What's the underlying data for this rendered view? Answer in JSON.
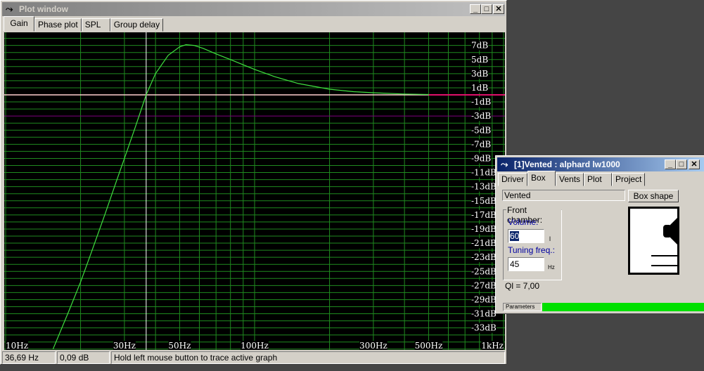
{
  "plot_window": {
    "title": "Plot window",
    "tabs": [
      {
        "label": "Gain",
        "active": true
      },
      {
        "label": "Phase plot"
      },
      {
        "label": "SPL"
      },
      {
        "label": "Group delay"
      }
    ],
    "status": {
      "freq": "36,69 Hz",
      "gain": "0,09 dB",
      "hint": "Hold left mouse button to trace active graph"
    }
  },
  "chart_data": {
    "type": "line",
    "xscale": "log",
    "xlim": [
      10,
      1000
    ],
    "ylim": [
      -36,
      9
    ],
    "grid": true,
    "x_tick_labels": [
      {
        "v": 10,
        "t": "10Hz"
      },
      {
        "v": 30,
        "t": "30Hz"
      },
      {
        "v": 50,
        "t": "50Hz"
      },
      {
        "v": 100,
        "t": "100Hz"
      },
      {
        "v": 300,
        "t": "300Hz"
      },
      {
        "v": 500,
        "t": "500Hz"
      },
      {
        "v": 1000,
        "t": "1kHz"
      }
    ],
    "y_tick_labels": [
      {
        "v": 7,
        "t": "7dB"
      },
      {
        "v": 5,
        "t": "5dB"
      },
      {
        "v": 3,
        "t": "3dB"
      },
      {
        "v": 1,
        "t": "1dB"
      },
      {
        "v": -1,
        "t": "-1dB"
      },
      {
        "v": -3,
        "t": "-3dB"
      },
      {
        "v": -5,
        "t": "-5dB"
      },
      {
        "v": -7,
        "t": "-7dB"
      },
      {
        "v": -9,
        "t": "-9dB"
      },
      {
        "v": -11,
        "t": "-11dB"
      },
      {
        "v": -13,
        "t": "-13dB"
      },
      {
        "v": -15,
        "t": "-15dB"
      },
      {
        "v": -17,
        "t": "-17dB"
      },
      {
        "v": -19,
        "t": "-19dB"
      },
      {
        "v": -21,
        "t": "-21dB"
      },
      {
        "v": -23,
        "t": "-23dB"
      },
      {
        "v": -25,
        "t": "-25dB"
      },
      {
        "v": -27,
        "t": "-27dB"
      },
      {
        "v": -29,
        "t": "-29dB"
      },
      {
        "v": -31,
        "t": "-31dB"
      },
      {
        "v": -33,
        "t": "-33dB"
      }
    ],
    "cursor_x": 36.69,
    "series": [
      {
        "color": "#40e040",
        "x": [
          15.5,
          18,
          20,
          22,
          25,
          28,
          30,
          33,
          36.69,
          40,
          45,
          50,
          53,
          57,
          62,
          70,
          80,
          100,
          120,
          150,
          200,
          250,
          300,
          400,
          500
        ],
        "y": [
          -36,
          -30.5,
          -26.5,
          -22.5,
          -17,
          -12,
          -9,
          -4.8,
          0,
          3,
          5.6,
          6.8,
          7.1,
          7.0,
          6.6,
          5.8,
          5,
          3.6,
          2.6,
          1.6,
          0.8,
          0.45,
          0.3,
          0.12,
          0.05
        ]
      }
    ],
    "reference_lines": [
      {
        "y": 0,
        "color": "#ffd0d0"
      },
      {
        "y": -3,
        "color": "#800080"
      }
    ],
    "colors": {
      "background": "#000000",
      "grid": "#1f8a1f",
      "cursor": "#ffffff",
      "zero_line_tail": "#e0106a"
    }
  },
  "box_window": {
    "title": "[1]Vented : alphard lw1000",
    "tabs": [
      {
        "label": "Driver"
      },
      {
        "label": "Box",
        "active": true
      },
      {
        "label": "Vents"
      },
      {
        "label": "Plot"
      },
      {
        "label": "Project"
      }
    ],
    "box_type": "Vented",
    "box_shape_button": "Box shape",
    "group_label": "Front chamber:",
    "volume_label": "Volume:",
    "volume_value": "60",
    "volume_unit": "l",
    "tuning_label": "Tuning freq.:",
    "tuning_value": "45",
    "tuning_unit": "Hz",
    "ql": "Ql = 7,00",
    "status_label": "Parameters",
    "progress": 1.0
  }
}
